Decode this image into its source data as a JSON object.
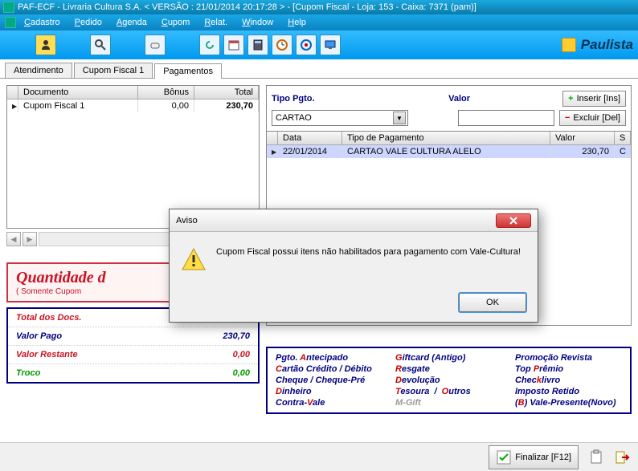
{
  "window": {
    "title": "PAF-ECF - Livraria Cultura S.A. < VERSÃO : 21/01/2014 20:17:28 >  - [Cupom Fiscal - Loja: 153 - Caixa: 7371 (pam)]"
  },
  "menu": {
    "items": [
      "Cadastro",
      "Pedido",
      "Agenda",
      "Cupom",
      "Relat.",
      "Window",
      "Help"
    ]
  },
  "toolbar": {
    "brand": "Paulista"
  },
  "tabs": {
    "items": [
      "Atendimento",
      "Cupom Fiscal 1",
      "Pagamentos"
    ],
    "activeIndex": 2
  },
  "docGrid": {
    "headers": {
      "doc": "Documento",
      "bonus": "Bônus",
      "total": "Total"
    },
    "rows": [
      {
        "doc": "Cupom Fiscal 1",
        "bonus": "0,00",
        "total": "230,70"
      }
    ]
  },
  "payPanel": {
    "tipoLabel": "Tipo Pgto.",
    "tipoValue": "CARTAO",
    "valorLabel": "Valor",
    "valorValue": "",
    "inserir": "Inserir [Ins]",
    "excluir": "Excluir [Del]",
    "headers": {
      "data": "Data",
      "tipo": "Tipo de Pagamento",
      "valor": "Valor",
      "s": "S"
    },
    "rows": [
      {
        "data": "22/01/2014",
        "tipo": "CARTAO VALE CULTURA ALELO",
        "valor": "230,70",
        "s": "C"
      }
    ]
  },
  "qty": {
    "title": "Quantidade d",
    "subtitle": "( Somente Cupom"
  },
  "totals": {
    "rows": [
      {
        "label": "Total dos Docs.",
        "value": "",
        "color": "#cc1122"
      },
      {
        "label": "Valor Pago",
        "value": "230,70",
        "color": "#000080"
      },
      {
        "label": "Valor Restante",
        "value": "0,00",
        "color": "#cc1122"
      },
      {
        "label": "Troco",
        "value": "0,00",
        "color": "#009900"
      }
    ]
  },
  "payOptions": [
    {
      "text": "Pgto. Antecipado",
      "hk": "A",
      "col": 1
    },
    {
      "text": "Cartão Crédito / Débito",
      "hk": "C",
      "col": 1
    },
    {
      "text": "Cheque / Cheque-Pré",
      "hk": "",
      "col": 1
    },
    {
      "text": "Dinheiro",
      "hk": "D",
      "col": 1
    },
    {
      "text": "Contra-Vale",
      "hk": "V",
      "col": 1
    },
    {
      "text": "Giftcard (Antigo)",
      "hk": "G",
      "col": 2
    },
    {
      "text": "Resgate",
      "hk": "R",
      "col": 2
    },
    {
      "text": "Devolução",
      "hk": "D",
      "col": 2
    },
    {
      "text": "Tesoura  /  Outros",
      "hk": "T",
      "col": 2
    },
    {
      "text": "M-Gift",
      "hk": "",
      "col": 2,
      "dim": true
    },
    {
      "text": "Promoção Revista",
      "hk": "",
      "col": 3
    },
    {
      "text": "Top Prêmio",
      "hk": "P",
      "col": 3
    },
    {
      "text": "Checklivro",
      "hk": "k",
      "col": 3
    },
    {
      "text": "Imposto Retido",
      "hk": "",
      "col": 3
    },
    {
      "text": "(B) Vale-Presente(Novo)",
      "hk": "B",
      "col": 3
    }
  ],
  "footer": {
    "finalizar": "Finalizar [F12]"
  },
  "modal": {
    "title": "Aviso",
    "message": "Cupom Fiscal possui itens não habilitados para pagamento com Vale-Cultura!",
    "ok": "OK"
  }
}
